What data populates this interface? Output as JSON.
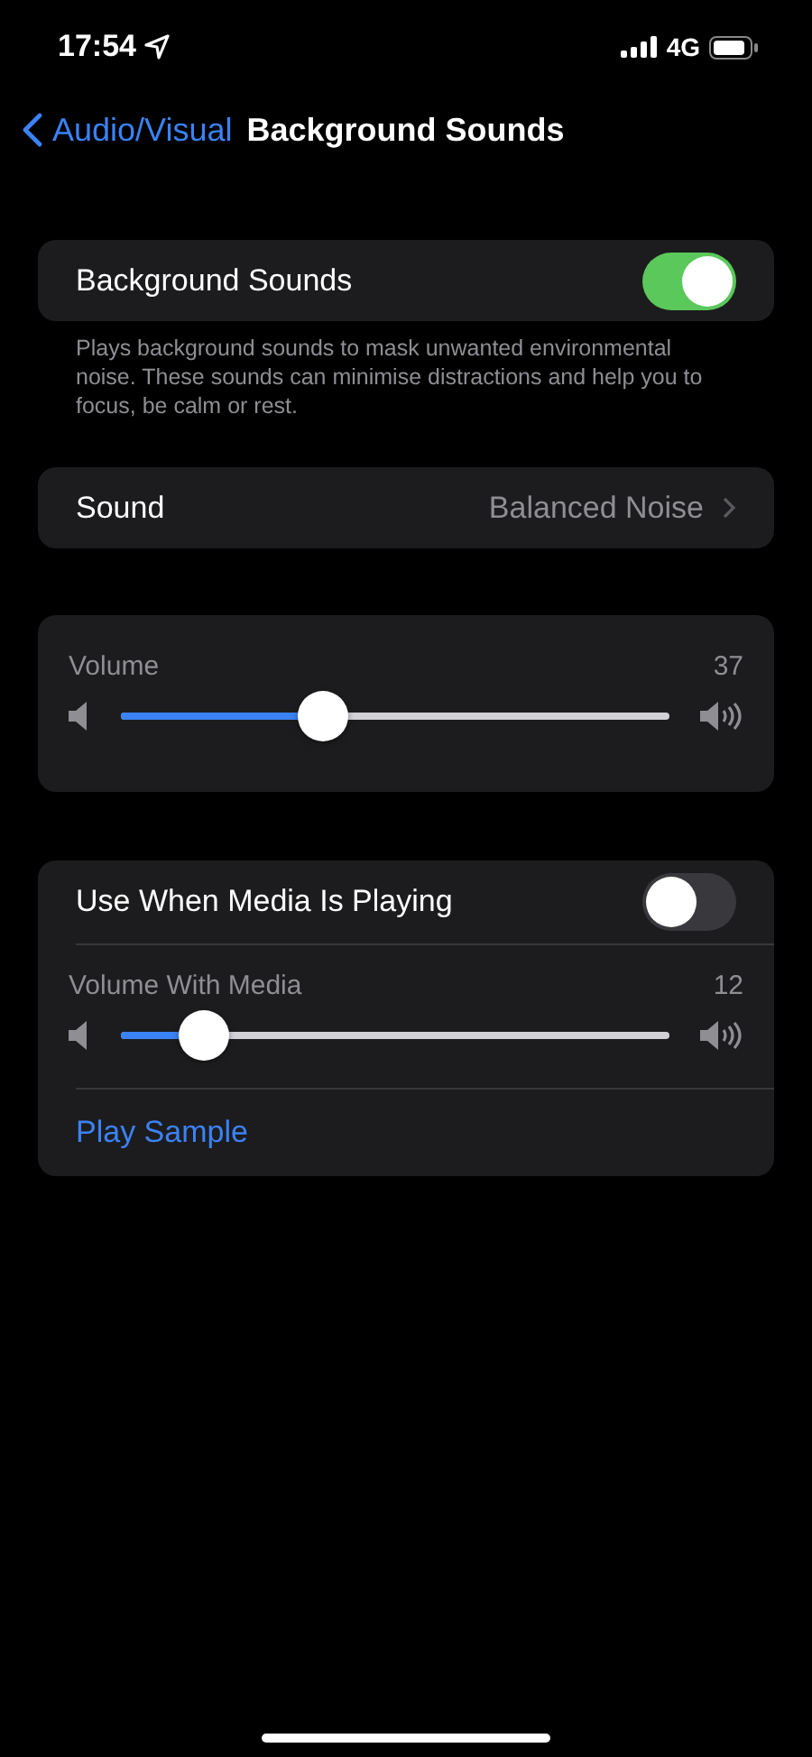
{
  "status_bar": {
    "time": "17:54",
    "network": "4G"
  },
  "nav": {
    "back": "Audio/Visual",
    "title": "Background Sounds"
  },
  "background_sounds": {
    "label": "Background Sounds",
    "on": true,
    "footer": "Plays background sounds to mask unwanted environmental noise. These sounds can minimise distractions and help you to focus, be calm or rest."
  },
  "sound": {
    "label": "Sound",
    "value": "Balanced Noise"
  },
  "volume": {
    "label": "Volume",
    "reading": "37",
    "level": 0.37
  },
  "media": {
    "label": "Use When Media Is Playing",
    "on": false,
    "volume_label": "Volume With Media",
    "reading": "12",
    "level": 0.15,
    "action": "Play Sample"
  }
}
